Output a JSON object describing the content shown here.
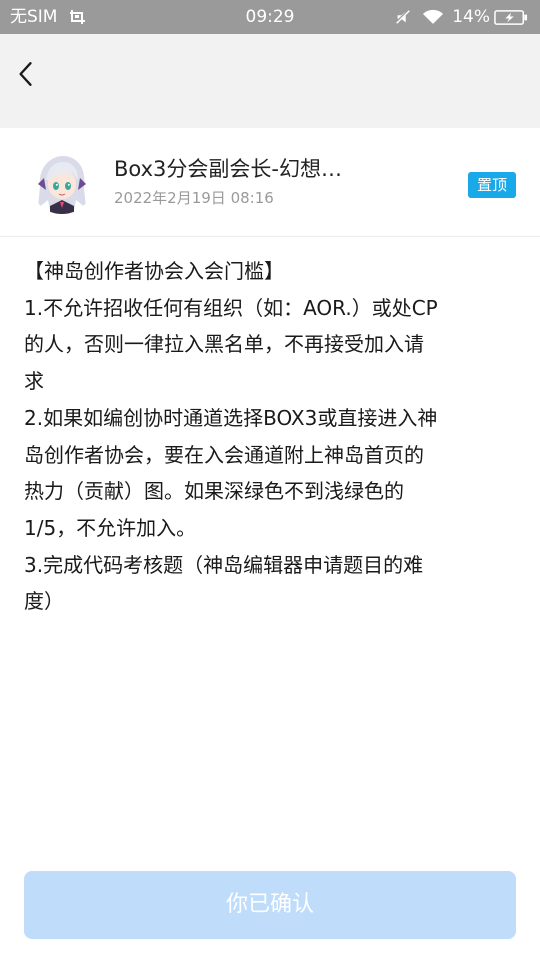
{
  "status_bar": {
    "carrier": "无SIM",
    "time": "09:29",
    "battery": "14%"
  },
  "post": {
    "author": "Box3分会副会长-幻想…",
    "date": "2022年2月19日 08:16",
    "pin_label": "置顶",
    "lines": [
      "【神岛创作者协会入会门槛】",
      "1.不允许招收任何有组织（如：AOR.）或处CP",
      "的人，否则一律拉入黑名单，不再接受加入请",
      "求",
      "2.如果如编创协时通道选择BOX3或直接进入神",
      "岛创作者协会，要在入会通道附上神岛首页的",
      "热力（贡献）图。如果深绿色不到浅绿色的",
      "1/5，不允许加入。",
      "3.完成代码考核题（神岛编辑器申请题目的难",
      "度）"
    ]
  },
  "footer": {
    "confirm_label": "你已确认"
  },
  "colors": {
    "status_bar_bg": "#9a9a9a",
    "nav_bg": "#f2f2f2",
    "pin_badge": "#19a9e8",
    "confirm_button_disabled": "#bfdcfa"
  }
}
